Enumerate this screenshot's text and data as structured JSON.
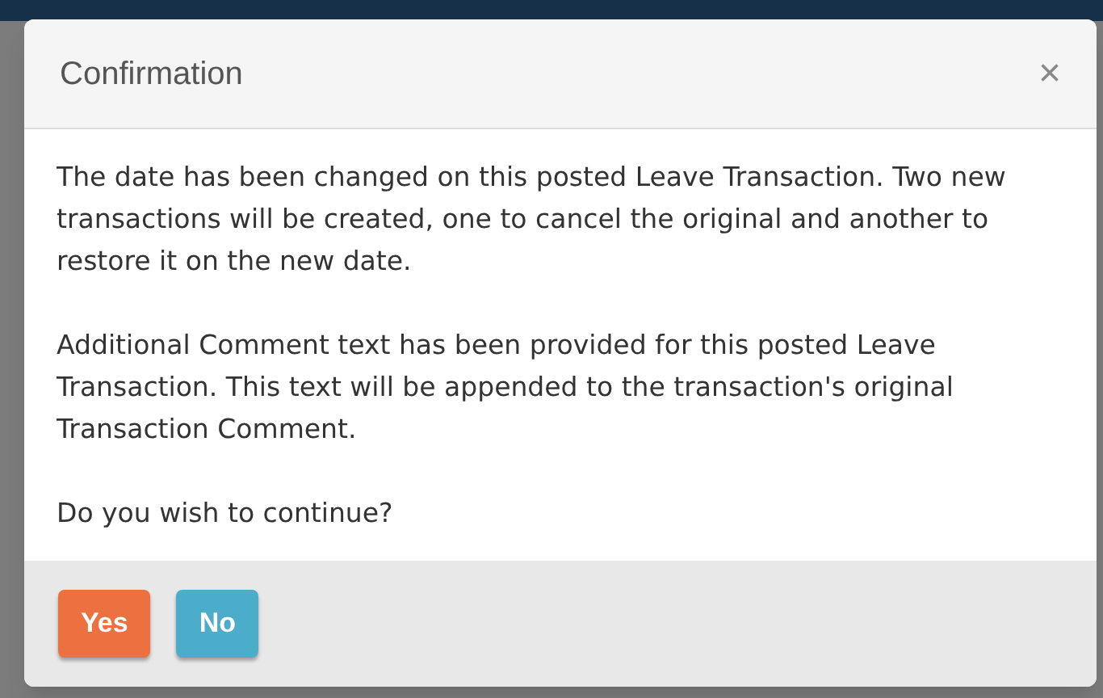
{
  "dialog": {
    "title": "Confirmation",
    "close": "×",
    "paragraphs": [
      "The date has been changed on this posted Leave Transaction. Two new transactions will be created, one to cancel the original and another to restore it on the new date.",
      "Additional Comment text has been provided for this posted Leave Transaction. This text will be appended to the transaction's original Transaction Comment.",
      "Do you wish to continue?"
    ],
    "buttons": [
      {
        "label": "Yes",
        "kind": "primary"
      },
      {
        "label": "No",
        "kind": "info"
      }
    ]
  }
}
